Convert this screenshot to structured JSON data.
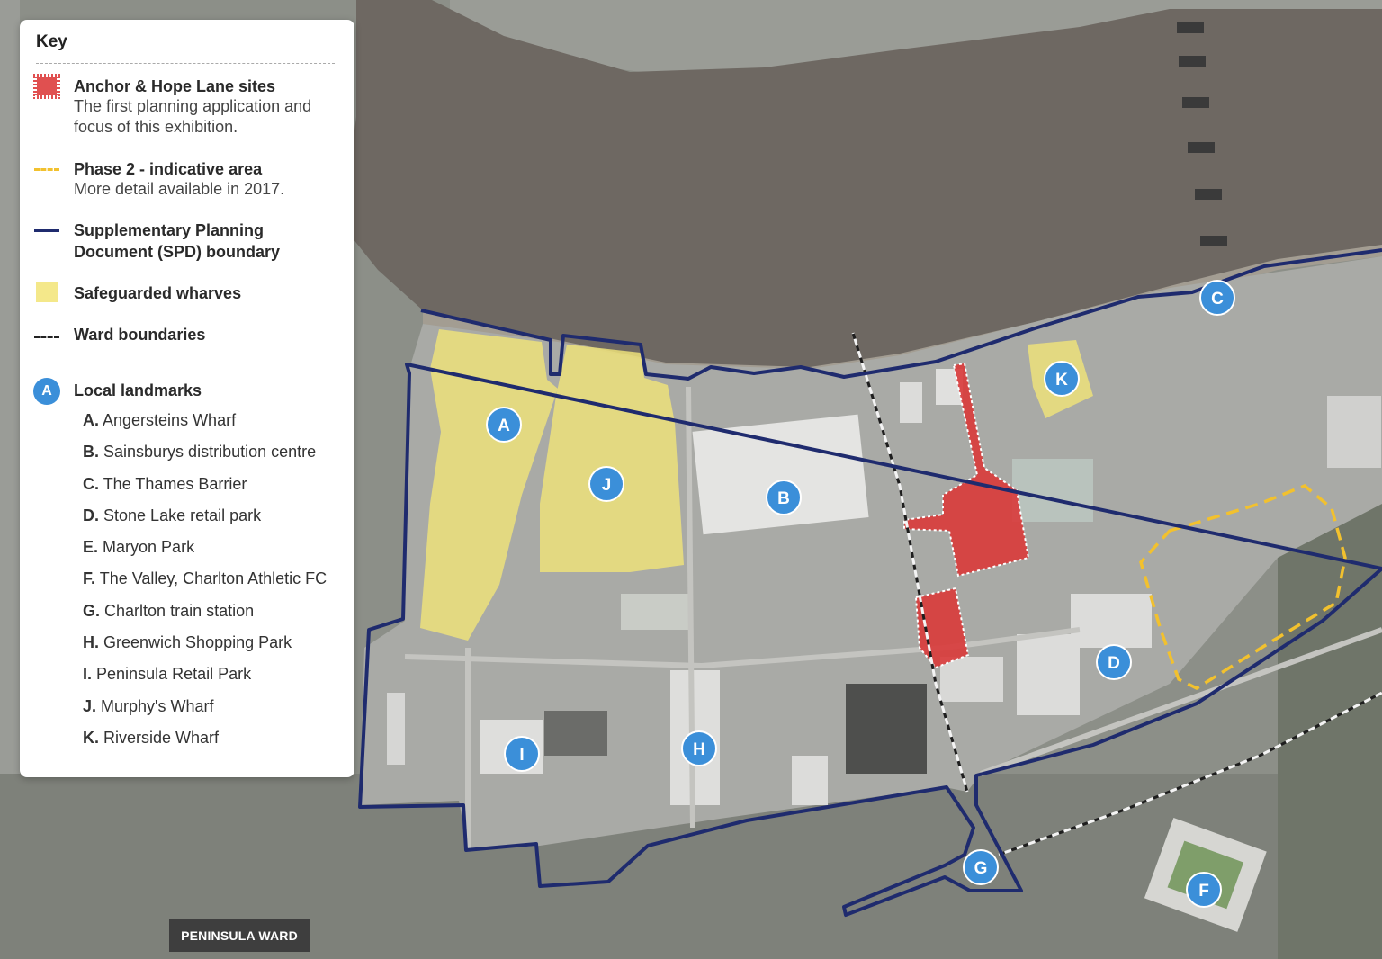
{
  "key": {
    "title": "Key",
    "anchor_hope": {
      "title": "Anchor & Hope Lane sites",
      "desc_line1": "The first planning application and",
      "desc_line2": "focus of this exhibition.",
      "color": "#e05050"
    },
    "phase2": {
      "title": "Phase 2 - indicative area",
      "desc": "More detail available in 2017.",
      "color": "#f2c12e"
    },
    "spd": {
      "title_line1": "Supplementary Planning",
      "title_line2": "Document (SPD) boundary",
      "color": "#1f2b6e"
    },
    "wharves": {
      "title": "Safeguarded wharves",
      "color": "#f4e88a"
    },
    "ward": {
      "title": "Ward boundaries"
    },
    "landmarks": {
      "symbol": "A",
      "title": "Local landmarks",
      "color": "#3b8fd9",
      "items": [
        {
          "letter": "A.",
          "name": "Angersteins Wharf"
        },
        {
          "letter": "B.",
          "name": "Sainsburys distribution centre"
        },
        {
          "letter": "C.",
          "name": "The Thames Barrier"
        },
        {
          "letter": "D.",
          "name": "Stone Lake retail park"
        },
        {
          "letter": "E.",
          "name": "Maryon Park"
        },
        {
          "letter": "F.",
          "name": "The Valley, Charlton Athletic FC"
        },
        {
          "letter": "G.",
          "name": "Charlton train station"
        },
        {
          "letter": "H.",
          "name": "Greenwich Shopping Park"
        },
        {
          "letter": "I.",
          "name": "Peninsula Retail Park"
        },
        {
          "letter": "J.",
          "name": "Murphy's Wharf"
        },
        {
          "letter": "K.",
          "name": "Riverside Wharf"
        }
      ]
    }
  },
  "map": {
    "ward_label": "PENINSULA WARD",
    "markers": {
      "A": "A",
      "B": "B",
      "C": "C",
      "D": "D",
      "F": "F",
      "G": "G",
      "H": "H",
      "I": "I",
      "J": "J",
      "K": "K"
    }
  }
}
